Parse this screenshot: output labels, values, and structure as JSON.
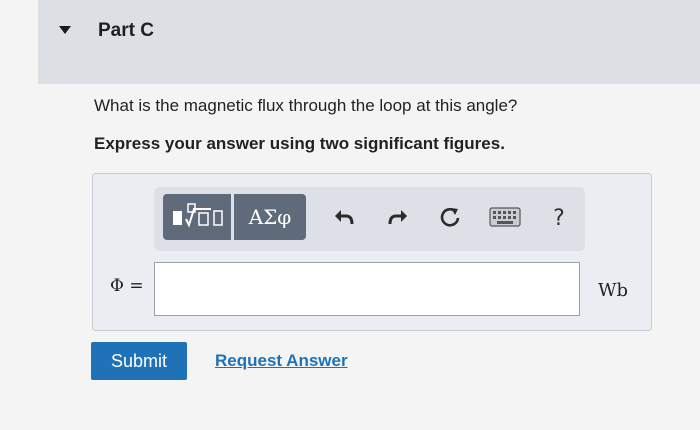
{
  "part": {
    "title": "Part C"
  },
  "question": {
    "text": "What is the magnetic flux through the loop at this angle?",
    "instruction": "Express your answer using two significant figures."
  },
  "toolbar": {
    "symbols_label": "ΑΣφ",
    "help_label": "?",
    "icons": [
      "templates-icon",
      "undo-icon",
      "redo-icon",
      "reset-icon",
      "keyboard-icon"
    ]
  },
  "answer": {
    "variable_label": "Φ =",
    "value": "",
    "unit": "Wb"
  },
  "actions": {
    "submit_label": "Submit",
    "request_label": "Request Answer"
  },
  "colors": {
    "accent": "#1f72b8",
    "toolbar_button": "#5f6b7a",
    "header_bg": "#dcdfe4"
  }
}
